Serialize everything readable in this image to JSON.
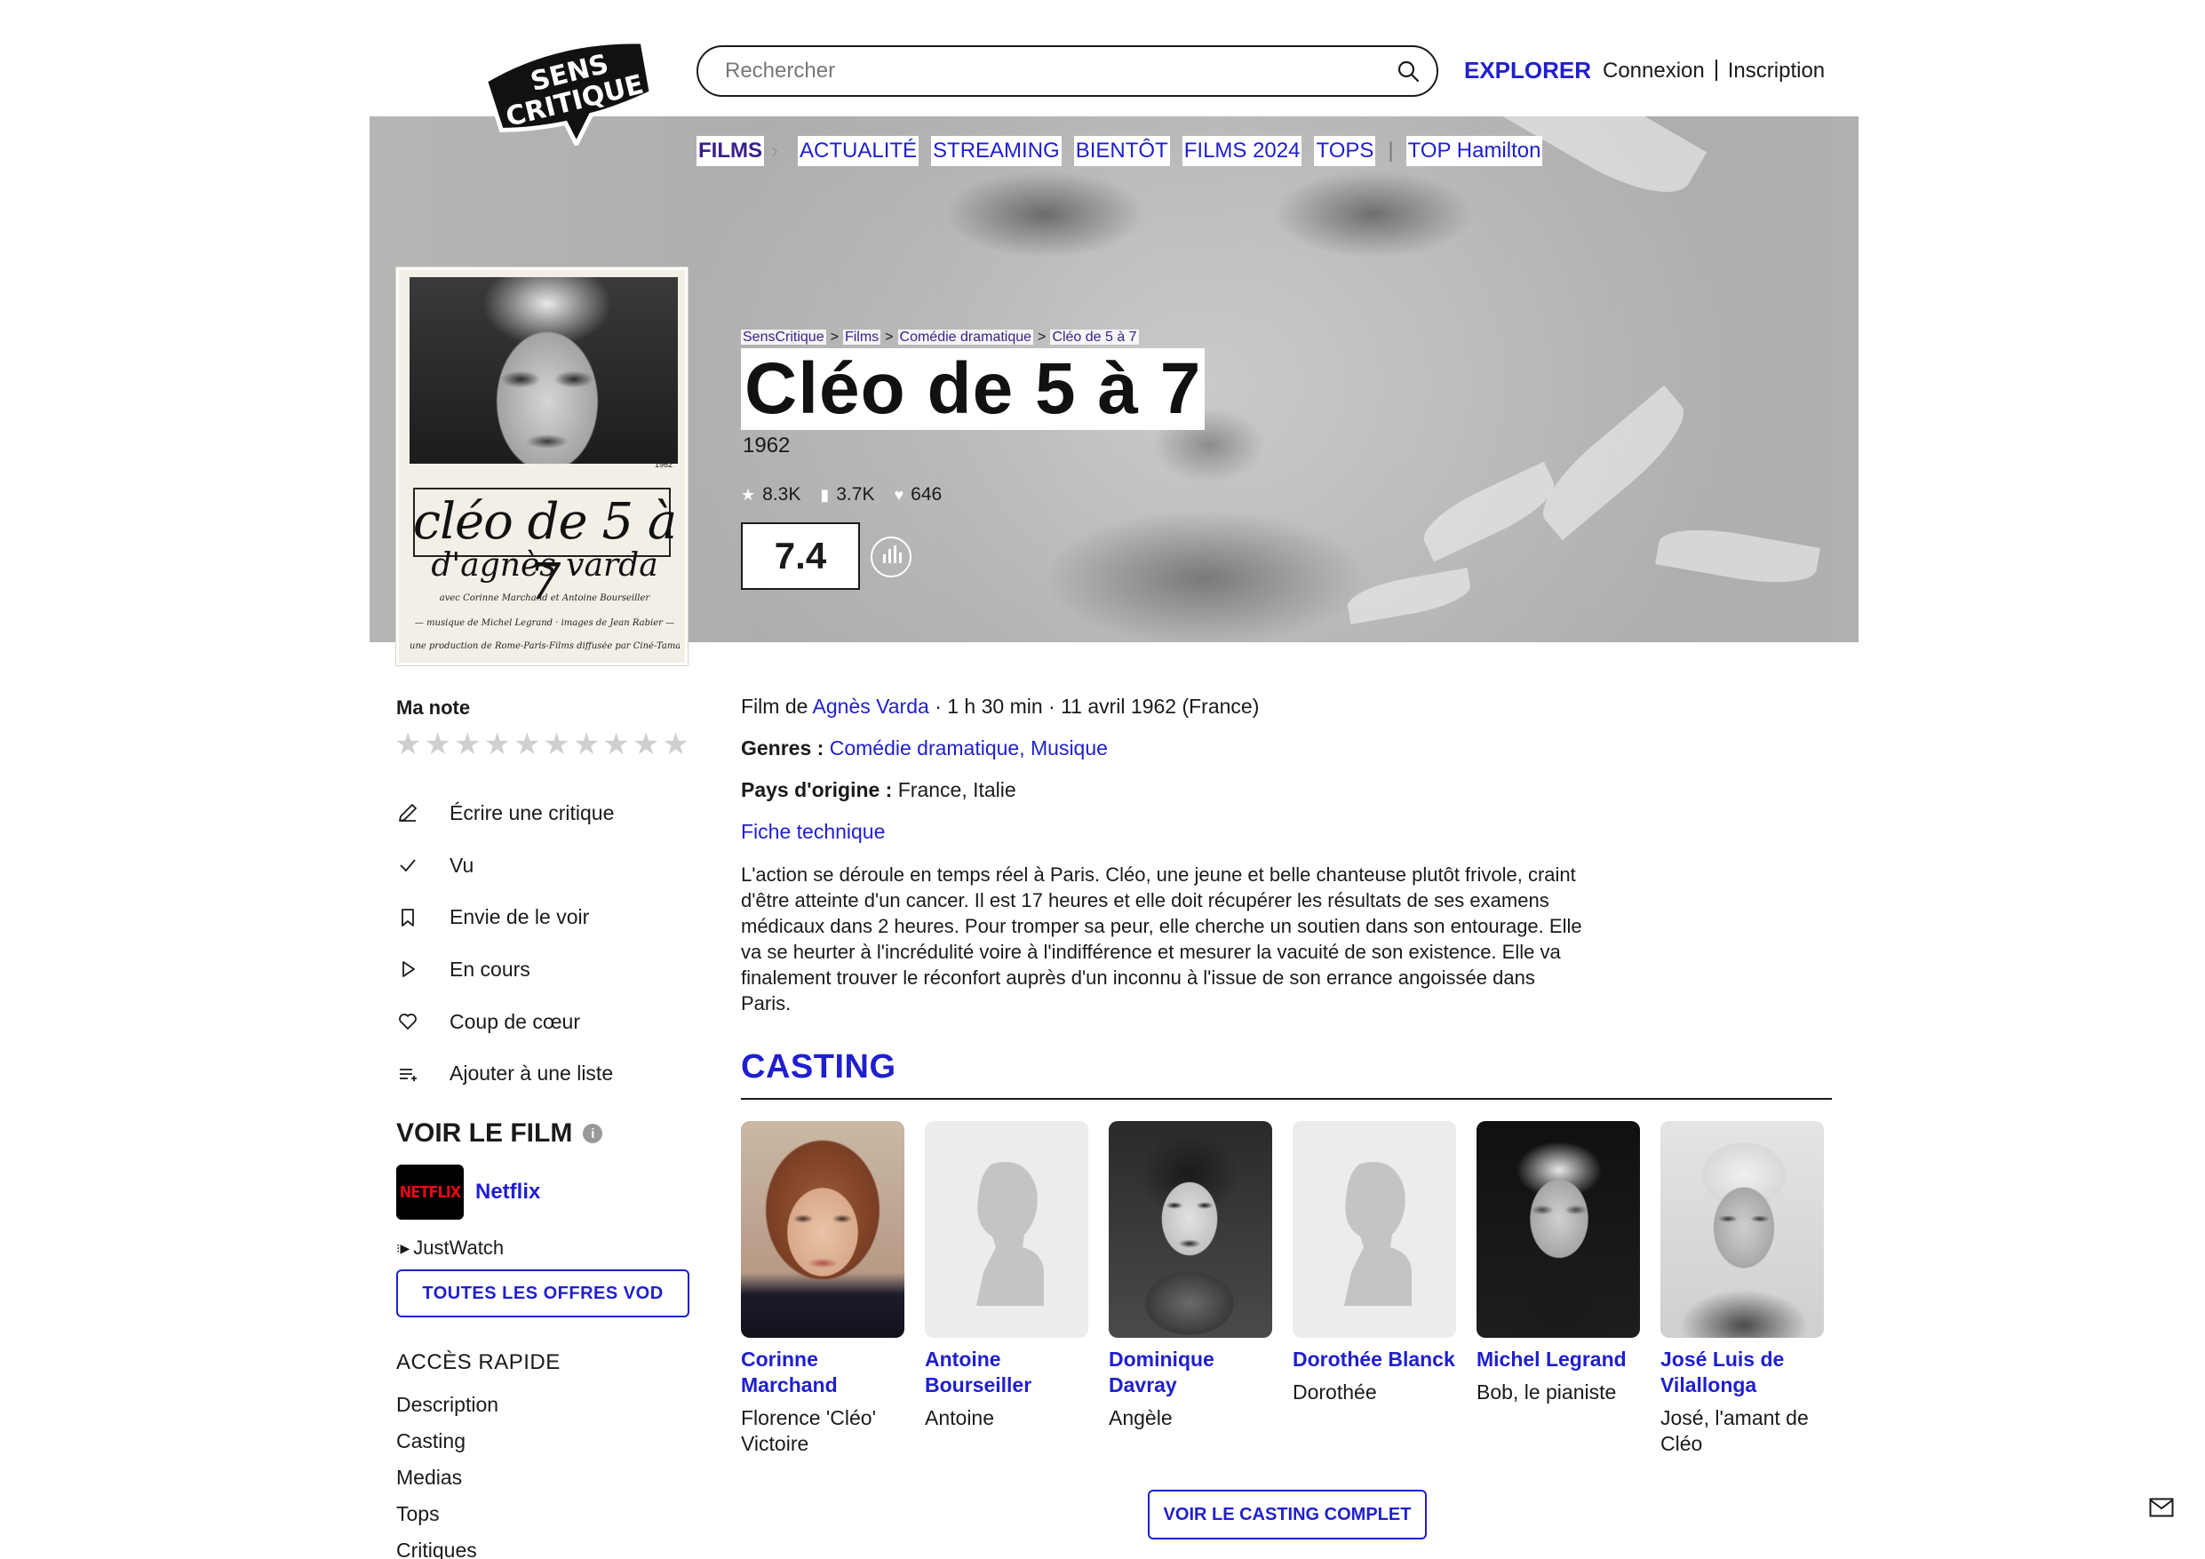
{
  "header": {
    "logo_line1": "SENS",
    "logo_line2": "CRITIQUE",
    "search_placeholder": "Rechercher",
    "explorer": "EXPLORER",
    "login": "Connexion",
    "signup": "Inscription"
  },
  "nav": {
    "films": "FILMS",
    "items": [
      "ACTUALITÉ",
      "STREAMING",
      "BIENTÔT",
      "FILMS 2024",
      "TOPS"
    ],
    "top_hamilton": "TOP Hamilton"
  },
  "breadcrumb": [
    "SensCritique",
    "Films",
    "Comédie dramatique",
    "Cléo de 5 à 7"
  ],
  "film": {
    "title": "Cléo de 5 à 7",
    "year": "1962",
    "stats": {
      "ratings": "8.3K",
      "wish": "3.7K",
      "favorites": "646"
    },
    "score": "7.4",
    "meta_prefix": "Film de",
    "director": "Agnès Varda",
    "meta_suffix": "· 1 h 30 min · 11 avril 1962 (France)",
    "genres_label": "Genres :",
    "genres": "Comédie dramatique, Musique",
    "pays_label": "Pays d'origine :",
    "pays": "France, Italie",
    "fiche": "Fiche technique",
    "synopsis": "L'action se déroule en temps réel à Paris. Cléo, une jeune et belle chanteuse plutôt frivole, craint d'être atteinte d'un cancer. Il est 17 heures et elle doit récupérer les résultats de ses examens médicaux dans 2 heures. Pour tromper sa peur, elle cherche un soutien dans son entourage. Elle va se heurter à l'incrédulité voire à l'indifférence et mesurer la vacuité de son existence. Elle va finalement trouver le réconfort auprès d'un inconnu à l'issue de son errance angoissée dans Paris."
  },
  "poster": {
    "number": "1962",
    "title": "cléo de 5 à 7",
    "subtitle": "d'agnès varda",
    "credit1": "avec Corinne Marchand et Antoine Bourseiller",
    "credit2": "— musique de Michel Legrand · images de Jean Rabier —",
    "credit3": "une production de Rome-Paris-Films diffusée par Ciné-Tamaris · J.M.R.I."
  },
  "sidebar": {
    "ma_note": "Ma note",
    "actions": [
      "Écrire une critique",
      "Vu",
      "Envie de le voir",
      "En cours",
      "Coup de cœur",
      "Ajouter à une liste"
    ],
    "voir_le_film": "VOIR LE FILM",
    "netflix_logo": "NETFLIX",
    "netflix": "Netflix",
    "justwatch": "JustWatch",
    "vod_button": "TOUTES LES OFFRES VOD",
    "acces_rapide": "ACCÈS RAPIDE",
    "quick_links": [
      "Description",
      "Casting",
      "Medias",
      "Tops",
      "Critiques"
    ]
  },
  "casting": {
    "heading": "CASTING",
    "members": [
      {
        "name": "Corinne Marchand",
        "role": "Florence 'Cléo' Victoire",
        "photo": "portrait-woman-red-hair"
      },
      {
        "name": "Antoine Bourseiller",
        "role": "Antoine",
        "photo": "silhouette"
      },
      {
        "name": "Dominique Davray",
        "role": "Angèle",
        "photo": "portrait-woman-bw"
      },
      {
        "name": "Dorothée Blanck",
        "role": "Dorothée",
        "photo": "silhouette"
      },
      {
        "name": "Michel Legrand",
        "role": "Bob, le pianiste",
        "photo": "portrait-man-glasses"
      },
      {
        "name": "José Luis de Vilallonga",
        "role": "José, l'amant de Cléo",
        "photo": "portrait-man-grey-hair"
      }
    ],
    "full_button": "VOIR LE CASTING COMPLET"
  },
  "colors": {
    "accent": "#1f1fcf",
    "nav_active": "#3b1e8c",
    "netflix_red": "#e50914"
  }
}
